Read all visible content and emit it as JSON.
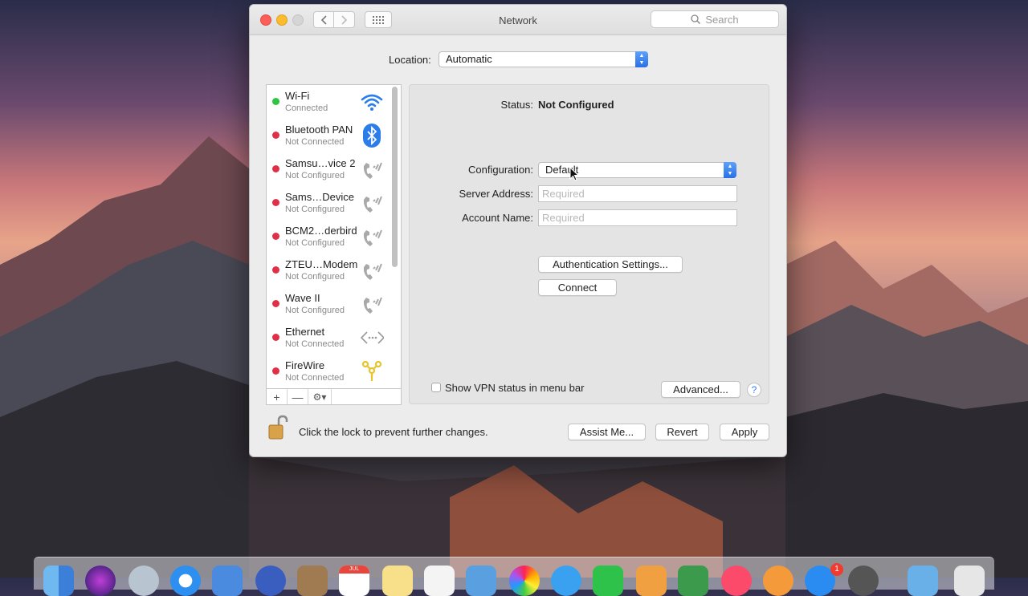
{
  "window": {
    "title": "Network",
    "search_placeholder": "Search"
  },
  "location": {
    "label": "Location:",
    "value": "Automatic"
  },
  "services": [
    {
      "name": "Wi-Fi",
      "status": "Connected",
      "status_color": "#2ec541",
      "icon": "wifi-icon"
    },
    {
      "name": "Bluetooth PAN",
      "status": "Not Connected",
      "status_color": "#e03048",
      "icon": "bluetooth-icon"
    },
    {
      "name": "Samsu…vice 2",
      "status": "Not Configured",
      "status_color": "#e03048",
      "icon": "phone-icon"
    },
    {
      "name": "Sams…Device",
      "status": "Not Configured",
      "status_color": "#e03048",
      "icon": "phone-icon"
    },
    {
      "name": "BCM2…derbird",
      "status": "Not Configured",
      "status_color": "#e03048",
      "icon": "phone-icon"
    },
    {
      "name": "ZTEU…Modem",
      "status": "Not Configured",
      "status_color": "#e03048",
      "icon": "phone-icon"
    },
    {
      "name": "Wave II",
      "status": "Not Configured",
      "status_color": "#e03048",
      "icon": "phone-icon"
    },
    {
      "name": "Ethernet",
      "status": "Not Connected",
      "status_color": "#e03048",
      "icon": "ethernet-icon"
    },
    {
      "name": "FireWire",
      "status": "Not Connected",
      "status_color": "#e03048",
      "icon": "firewire-icon"
    }
  ],
  "list_tools": {
    "add": "+",
    "remove": "—",
    "gear": "⚙▾"
  },
  "detail": {
    "status_label": "Status:",
    "status_value": "Not Configured",
    "configuration_label": "Configuration:",
    "configuration_value": "Default",
    "server_label": "Server Address:",
    "server_placeholder": "Required",
    "account_label": "Account Name:",
    "account_placeholder": "Required",
    "auth_button": "Authentication Settings...",
    "connect_button": "Connect",
    "vpn_checkbox_label": "Show VPN status in menu bar",
    "advanced_button": "Advanced...",
    "help": "?"
  },
  "footer": {
    "lock_text": "Click the lock to prevent further changes.",
    "assist_button": "Assist Me...",
    "revert_button": "Revert",
    "apply_button": "Apply"
  },
  "dock": {
    "calendar_month": "JUL",
    "app_store_badge": "1"
  }
}
